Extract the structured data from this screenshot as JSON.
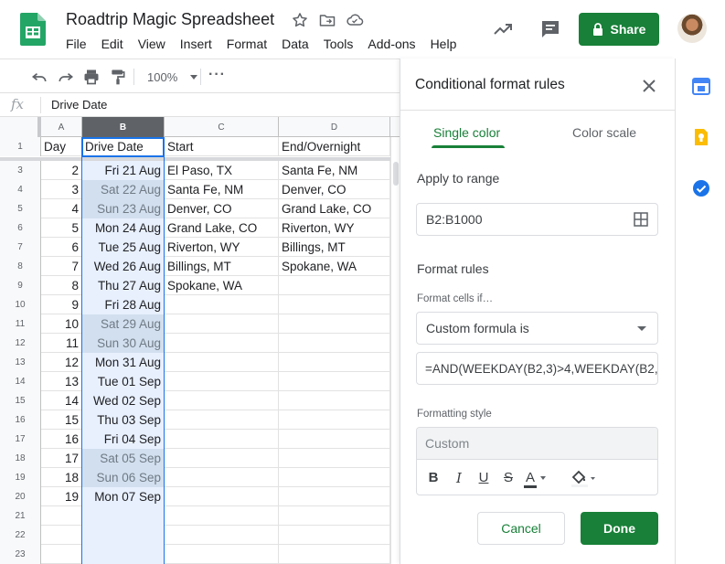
{
  "app": {
    "title": "Roadtrip Magic Spreadsheet",
    "menu": [
      "File",
      "Edit",
      "View",
      "Insert",
      "Format",
      "Data",
      "Tools",
      "Add-ons",
      "Help"
    ],
    "share_label": "Share",
    "brand_color": "#188038"
  },
  "toolbar": {
    "zoom": "100%"
  },
  "formula_bar": {
    "fx": "fx",
    "value": "Drive Date"
  },
  "sheet": {
    "columns": [
      "A",
      "B",
      "C",
      "D"
    ],
    "selected_column": "B",
    "header_row": {
      "num": "1",
      "a": "Day",
      "b": "Drive Date",
      "c": "Start",
      "d": "End/Overnight"
    },
    "rows": [
      {
        "num": "3",
        "a": "2",
        "b": "Fri 21 Aug",
        "c": "El Paso, TX",
        "d": "Santa Fe, NM",
        "weekend": false
      },
      {
        "num": "4",
        "a": "3",
        "b": "Sat 22 Aug",
        "c": "Santa Fe, NM",
        "d": "Denver, CO",
        "weekend": true
      },
      {
        "num": "5",
        "a": "4",
        "b": "Sun 23 Aug",
        "c": "Denver, CO",
        "d": "Grand Lake, CO",
        "weekend": true
      },
      {
        "num": "6",
        "a": "5",
        "b": "Mon 24 Aug",
        "c": "Grand Lake, CO",
        "d": "Riverton, WY",
        "weekend": false
      },
      {
        "num": "7",
        "a": "6",
        "b": "Tue 25 Aug",
        "c": "Riverton, WY",
        "d": "Billings, MT",
        "weekend": false
      },
      {
        "num": "8",
        "a": "7",
        "b": "Wed 26 Aug",
        "c": "Billings, MT",
        "d": "Spokane, WA",
        "weekend": false
      },
      {
        "num": "9",
        "a": "8",
        "b": "Thu 27 Aug",
        "c": "Spokane, WA",
        "d": "",
        "weekend": false
      },
      {
        "num": "10",
        "a": "9",
        "b": "Fri 28 Aug",
        "c": "",
        "d": "",
        "weekend": false
      },
      {
        "num": "11",
        "a": "10",
        "b": "Sat 29 Aug",
        "c": "",
        "d": "",
        "weekend": true
      },
      {
        "num": "12",
        "a": "11",
        "b": "Sun 30 Aug",
        "c": "",
        "d": "",
        "weekend": true
      },
      {
        "num": "13",
        "a": "12",
        "b": "Mon 31 Aug",
        "c": "",
        "d": "",
        "weekend": false
      },
      {
        "num": "14",
        "a": "13",
        "b": "Tue 01 Sep",
        "c": "",
        "d": "",
        "weekend": false
      },
      {
        "num": "15",
        "a": "14",
        "b": "Wed 02 Sep",
        "c": "",
        "d": "",
        "weekend": false
      },
      {
        "num": "16",
        "a": "15",
        "b": "Thu 03 Sep",
        "c": "",
        "d": "",
        "weekend": false
      },
      {
        "num": "17",
        "a": "16",
        "b": "Fri 04 Sep",
        "c": "",
        "d": "",
        "weekend": false
      },
      {
        "num": "18",
        "a": "17",
        "b": "Sat 05 Sep",
        "c": "",
        "d": "",
        "weekend": true
      },
      {
        "num": "19",
        "a": "18",
        "b": "Sun 06 Sep",
        "c": "",
        "d": "",
        "weekend": true
      },
      {
        "num": "20",
        "a": "19",
        "b": "Mon 07 Sep",
        "c": "",
        "d": "",
        "weekend": false
      },
      {
        "num": "21",
        "a": "",
        "b": "",
        "c": "",
        "d": "",
        "weekend": false
      },
      {
        "num": "22",
        "a": "",
        "b": "",
        "c": "",
        "d": "",
        "weekend": false
      },
      {
        "num": "23",
        "a": "",
        "b": "",
        "c": "",
        "d": "",
        "weekend": false
      }
    ]
  },
  "panel": {
    "title": "Conditional format rules",
    "tabs": {
      "single": "Single color",
      "scale": "Color scale"
    },
    "apply_to_range_label": "Apply to range",
    "range_value": "B2:B1000",
    "format_rules_label": "Format rules",
    "format_cells_if_label": "Format cells if…",
    "condition": "Custom formula is",
    "formula": "=AND(WEEKDAY(B2,3)>4,WEEKDAY(B2,",
    "formatting_style_label": "Formatting style",
    "style_preview": "Custom",
    "format_buttons": {
      "bold": "B",
      "italic": "I",
      "underline": "U",
      "strike": "S",
      "text_color": "A"
    },
    "cancel_label": "Cancel",
    "done_label": "Done"
  }
}
